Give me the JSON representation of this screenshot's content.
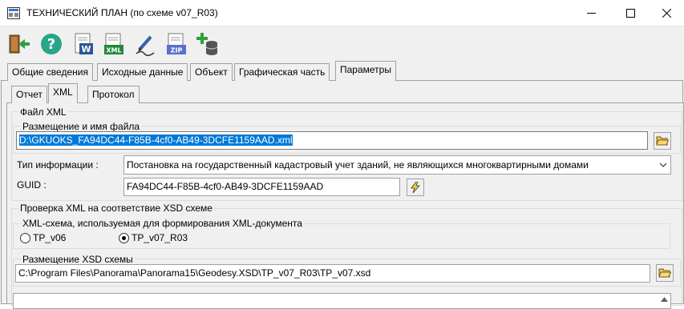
{
  "window": {
    "title": "ТЕХНИЧЕСКИЙ ПЛАН (по схеме v07_R03)",
    "controls": [
      "minimize-icon",
      "maximize-icon",
      "close-icon"
    ]
  },
  "toolbar": {
    "buttons": [
      "exit-icon",
      "help-icon",
      "word-export-icon",
      "xml-export-icon",
      "sign-icon",
      "zip-icon",
      "add-database-icon"
    ]
  },
  "tabs": {
    "main": [
      "Общие сведения",
      "Исходные данные",
      "Объект",
      "Графическая часть",
      "Параметры"
    ],
    "main_active": "Параметры",
    "sub": [
      "Отчет",
      "XML",
      "Протокол"
    ],
    "sub_active": "XML"
  },
  "xml_file": {
    "group_label": "Файл XML",
    "location_label": "Размещение и имя файла",
    "path_value": "D:\\GKUOKS_FA94DC44-F85B-4cf0-AB49-3DCFE1159AAD.xml",
    "info_type_label": "Тип информации :",
    "info_type_value": "Постановка на государственный кадастровый учет зданий, не являющихся многоквартирными домами",
    "guid_label": "GUID :",
    "guid_value": "FA94DC44-F85B-4cf0-AB49-3DCFE1159AAD"
  },
  "xsd_check": {
    "group_label": "Проверка XML на соответствие XSD схеме",
    "schema_label": "XML-схема, используемая для формирования XML-документа",
    "options": [
      {
        "label": "TP_v06",
        "selected": false
      },
      {
        "label": "TP_v07_R03",
        "selected": true
      }
    ],
    "xsd_location_label": "Размещение XSD схемы",
    "xsd_path_value": "C:\\Program Files\\Panorama\\Panorama15\\Geodesy.XSD\\TP_v07_R03\\TP_v07.xsd"
  },
  "colors": {
    "selection": "#0078d7",
    "panel_bg": "#f0f0f0"
  }
}
